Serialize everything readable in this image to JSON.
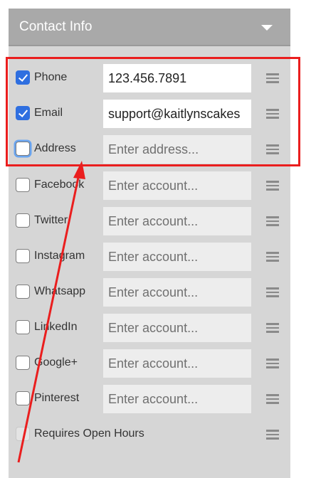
{
  "panel": {
    "title": "Contact Info",
    "collapse_icon": "caret-down-icon",
    "drag_icon": "drag-handle-icon"
  },
  "rows": [
    {
      "label": "Phone",
      "checked": true,
      "value": "123.456.7891",
      "placeholder": ""
    },
    {
      "label": "Email",
      "checked": true,
      "value": "support@kaitlynscakes",
      "placeholder": ""
    },
    {
      "label": "Address",
      "checked": false,
      "value": "",
      "placeholder": "Enter address..."
    },
    {
      "label": "Facebook",
      "checked": false,
      "value": "",
      "placeholder": "Enter account..."
    },
    {
      "label": "Twitter",
      "checked": false,
      "value": "",
      "placeholder": "Enter account..."
    },
    {
      "label": "Instagram",
      "checked": false,
      "value": "",
      "placeholder": "Enter account..."
    },
    {
      "label": "Whatsapp",
      "checked": false,
      "value": "",
      "placeholder": "Enter account..."
    },
    {
      "label": "LinkedIn",
      "checked": false,
      "value": "",
      "placeholder": "Enter account..."
    },
    {
      "label": "Google+",
      "checked": false,
      "value": "",
      "placeholder": "Enter account..."
    },
    {
      "label": "Pinterest",
      "checked": false,
      "value": "",
      "placeholder": "Enter account..."
    }
  ],
  "open_hours": {
    "label": "Requires Open Hours",
    "checked": false
  },
  "annotation": {
    "box_color": "#ea1e1e",
    "arrow_color": "#ea1e1e"
  }
}
